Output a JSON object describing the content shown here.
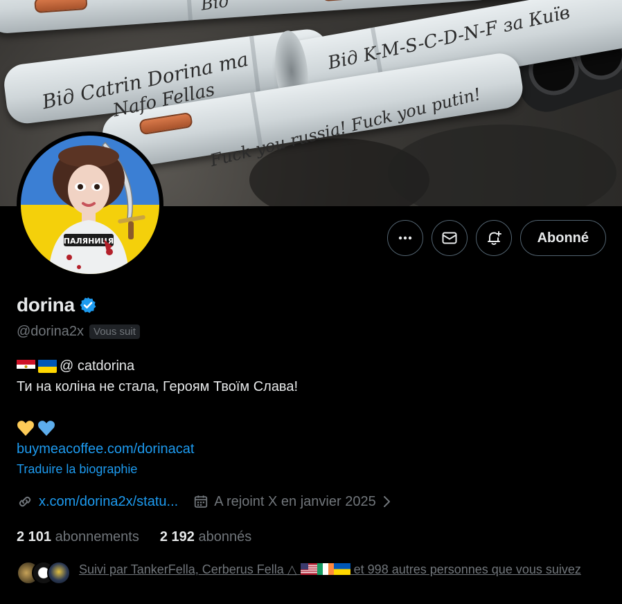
{
  "banner": {
    "scribbles": [
      "Від Catrin Dorina та",
      "Nafo Fellas",
      "Від K-M-S-C-D-N-F за Київ",
      "Fuck you russia! Fuck you putin!",
      "Від"
    ]
  },
  "actions": {
    "more_icon": "more-icon",
    "message_icon": "mail-icon",
    "notify_icon": "bell-plus-icon",
    "follow_label": "Abonné"
  },
  "profile": {
    "name": "dorina",
    "handle": "@dorina2x",
    "follows_you": "Vous suit"
  },
  "bio": {
    "line1_text": "@ catdorina",
    "line2": "Ти на коліна не стала, Героям Твоїм Слава!",
    "hearts": "💛💙",
    "link": "buymeacoffee.com/dorinacat",
    "translate": "Traduire la biographie"
  },
  "meta": {
    "website": "x.com/dorina2x/statu...",
    "joined": "A rejoint X en janvier 2025"
  },
  "stats": {
    "following_count": "2 101",
    "following_label": "abonnements",
    "followers_count": "2 192",
    "followers_label": "abonnés"
  },
  "followed_by": {
    "prefix": "Suivi par TankerFella, Cerberus Fella △",
    "suffix": " et 998 autres personnes que vous suivez"
  },
  "colors": {
    "accent": "#1d9bf0",
    "muted": "#71767b",
    "text": "#e7e9ea",
    "verified": "#1d9bf0"
  }
}
